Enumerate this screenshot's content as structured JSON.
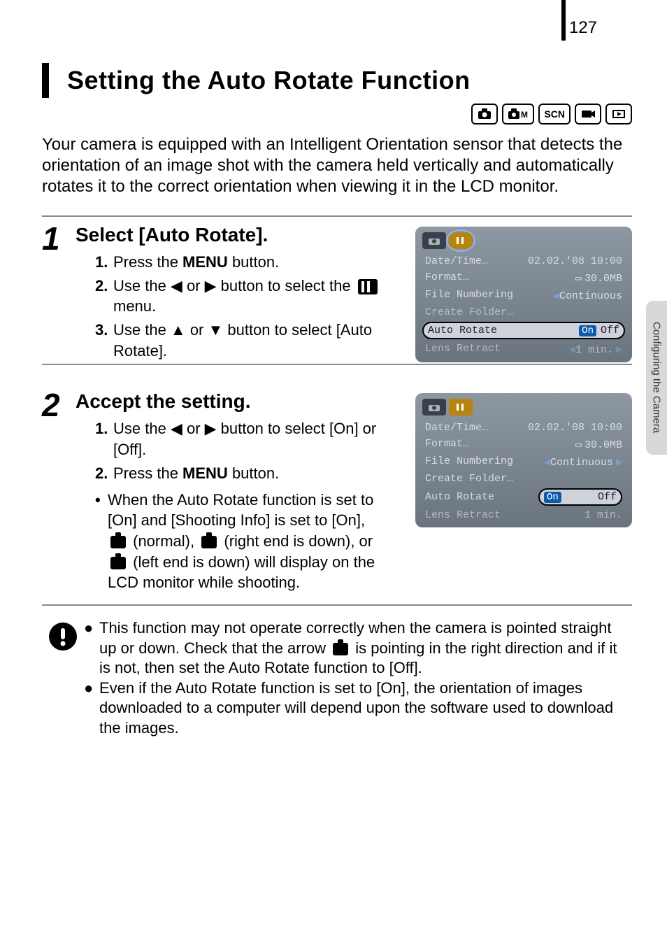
{
  "page_number": "127",
  "side_tab": "Configuring the Camera",
  "section_title": "Setting the Auto Rotate Function",
  "mode_icons": [
    "camera",
    "camera-m",
    "scn",
    "movie",
    "playback"
  ],
  "intro": "Your camera is equipped with an Intelligent Orientation sensor that detects the orientation of an image shot with the camera held vertically and automatically rotates it to the correct orientation when viewing it in the LCD monitor.",
  "step1": {
    "num": "1",
    "title": "Select [Auto Rotate].",
    "items": {
      "i1n": "1.",
      "i1a": "Press the ",
      "i1b": "MENU",
      "i1c": " button.",
      "i2n": "2.",
      "i2a": "Use the ◀ or ▶ button to select the ",
      "i2c": " menu.",
      "i3n": "3.",
      "i3": "Use the ▲ or ▼ button to select [Auto Rotate]."
    }
  },
  "step2": {
    "num": "2",
    "title": "Accept the setting.",
    "items": {
      "i1n": "1.",
      "i1": "Use the ◀ or ▶ button to select [On] or [Off].",
      "i2n": "2.",
      "i2a": "Press the ",
      "i2b": "MENU",
      "i2c": " button."
    },
    "bullet_a": "When the Auto Rotate function is set to [On] and [Shooting Info] is set to [On], ",
    "bullet_b": " (normal), ",
    "bullet_c": " (right end is down), or ",
    "bullet_d": " (left end is down) will display on the LCD monitor while shooting."
  },
  "menu": {
    "date_label": "Date/Time…",
    "date_value": "02.02.'08 10:00",
    "format_label": "Format…",
    "format_value": "30.0MB",
    "filenum_label": "File Numbering",
    "filenum_value": "Continuous",
    "folder_label": "Create Folder…",
    "autorotate_label": "Auto Rotate",
    "on_label": "On",
    "off_label": "Off",
    "lens_label": "Lens Retract",
    "lens_value": "1 min."
  },
  "caution": {
    "c1a": "This function may not operate correctly when the camera is pointed straight up or down. Check that the arrow ",
    "c1b": " is pointing in the right direction and if it is not, then set the Auto Rotate function to [Off].",
    "c2": "Even if the Auto Rotate function is set to [On], the orientation of images downloaded to a computer will depend upon the software used to download the images."
  }
}
